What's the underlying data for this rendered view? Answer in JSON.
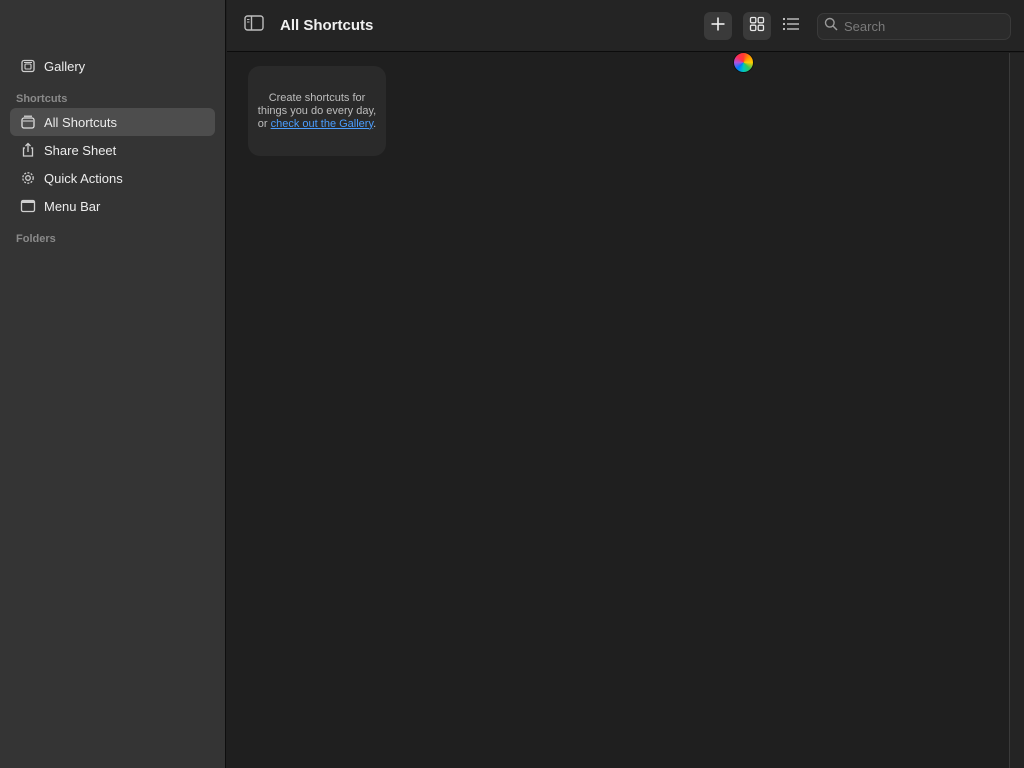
{
  "sidebar": {
    "gallery": {
      "label": "Gallery",
      "icon": "gallery-icon"
    },
    "shortcuts_section": "Shortcuts",
    "items": [
      {
        "label": "All Shortcuts",
        "icon": "stack-icon",
        "selected": true
      },
      {
        "label": "Share Sheet",
        "icon": "share-icon",
        "selected": false
      },
      {
        "label": "Quick Actions",
        "icon": "gear-icon",
        "selected": false
      },
      {
        "label": "Menu Bar",
        "icon": "menubar-icon",
        "selected": false
      }
    ],
    "folders_section": "Folders"
  },
  "toolbar": {
    "title": "All Shortcuts",
    "add_icon": "plus-icon",
    "grid_icon": "grid-view-icon",
    "list_icon": "list-view-icon",
    "search_placeholder": "Search",
    "search_value": ""
  },
  "main": {
    "empty_card": {
      "text_before": "Create shortcuts for things you do every day, or ",
      "link_text": "check out the Gallery",
      "text_after": "."
    }
  },
  "colors": {
    "sidebar_bg": "#343434",
    "content_bg": "#1f1f1f",
    "selected_bg": "#4d4d4d",
    "link": "#4a9dff"
  }
}
